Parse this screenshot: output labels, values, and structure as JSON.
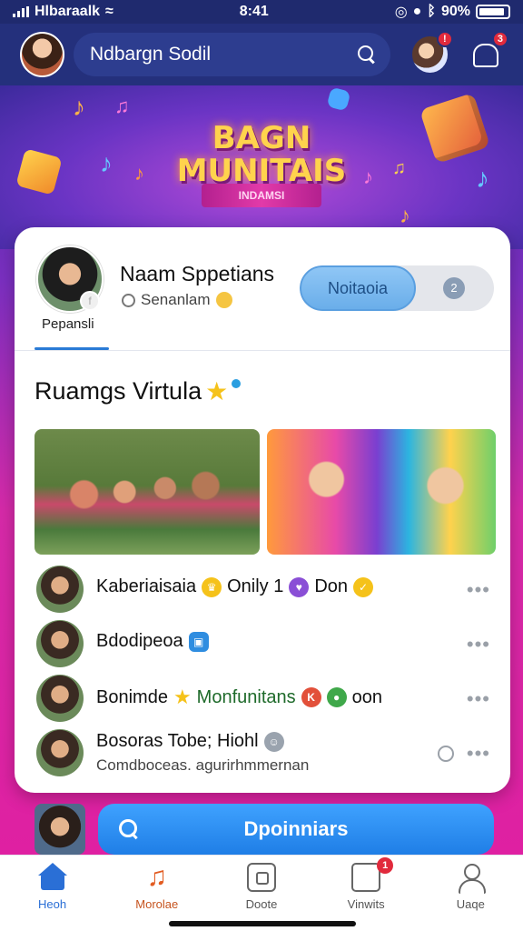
{
  "status_bar": {
    "carrier": "Hlbaraalk",
    "time": "8:41",
    "battery": "90%"
  },
  "header": {
    "title": "Ndbargn Sodil",
    "notification_count": "3",
    "people_badge": "!"
  },
  "banner": {
    "title_line1": "BAGN",
    "title_line2": "MUNITAIS",
    "ribbon_text": "INDAMSI"
  },
  "profile": {
    "name": "Naam Sppetians",
    "subtitle": "Senanlam",
    "caption": "Pepansli",
    "toggle_active_label": "Noitaoia",
    "toggle_icon_glyph": "2"
  },
  "section": {
    "title": "Ruamgs Virtula"
  },
  "list": [
    {
      "title": "Kaberiaisaia",
      "extra1": "Onily 1",
      "extra2": "Don",
      "subtitle": ""
    },
    {
      "title": "Bdodipeoa",
      "extra1": "",
      "extra2": "",
      "subtitle": ""
    },
    {
      "title": "Bonimde",
      "extra1": "Monfunitans",
      "extra2": "oon",
      "subtitle": ""
    },
    {
      "title": "Bosoras Tobe; Hiohl",
      "extra1": "",
      "extra2": "",
      "subtitle": "Comdboceas. agurirhmmernan"
    }
  ],
  "cta": {
    "label": "Dpoinniars"
  },
  "tabs": [
    {
      "label": "Heoh"
    },
    {
      "label": "Morolae"
    },
    {
      "label": "Doote"
    },
    {
      "label": "Vinwits",
      "badge": "1"
    },
    {
      "label": "Uaqe"
    }
  ],
  "colors": {
    "brand_blue": "#24307c",
    "accent_blue": "#2a7bd6",
    "magenta": "#e11ea0"
  }
}
